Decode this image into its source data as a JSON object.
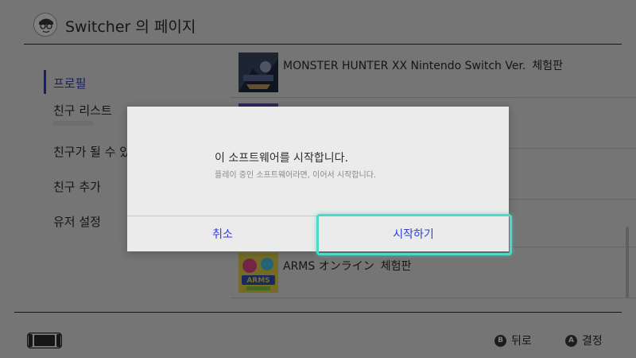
{
  "header": {
    "title": "Switcher 의 페이지",
    "avatar_icon": "user-avatar-icon"
  },
  "sidebar": {
    "items": [
      {
        "label": "프로필",
        "active": true
      },
      {
        "label": "친구 리스트",
        "active": false
      },
      {
        "label": "친구가 될 수 있",
        "active": false
      },
      {
        "label": "친구 추가",
        "active": false
      },
      {
        "label": "유저 설정",
        "active": false
      }
    ],
    "accent_color": "#2c3ed6"
  },
  "games": [
    {
      "title": "MONSTER HUNTER XX Nintendo Switch Ver.",
      "badge": "체험판"
    },
    {
      "title": "",
      "badge": ""
    },
    {
      "title": "",
      "badge": ""
    },
    {
      "title": "",
      "badge": ""
    },
    {
      "title": "ARMS オンライン",
      "badge": "체험판"
    }
  ],
  "dialog": {
    "message": "이 소프트웨어를 시작합니다.",
    "subtext": "플레이 중인 소프트웨어라면, 이어서 시작합니다.",
    "cancel_label": "취소",
    "confirm_label": "시작하기",
    "focus_color": "#4fd8c8"
  },
  "footer": {
    "console_icon": "console-handheld-icon",
    "back": {
      "glyph": "B",
      "label": "뒤로"
    },
    "ok": {
      "glyph": "A",
      "label": "결정"
    }
  }
}
